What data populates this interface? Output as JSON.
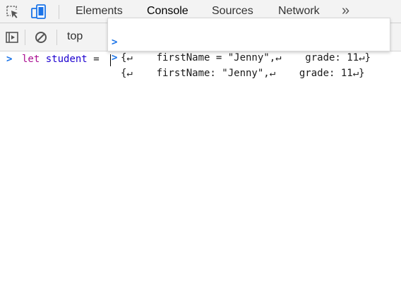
{
  "devtools": {
    "tabs": [
      {
        "label": "Elements",
        "active": false
      },
      {
        "label": "Console",
        "active": true
      },
      {
        "label": "Sources",
        "active": false
      },
      {
        "label": "Network",
        "active": false
      }
    ],
    "more_tabs_glyph": "»",
    "icons": {
      "inspect": "inspect-element-icon",
      "device": "device-toolbar-icon",
      "sidebar": "show-console-sidebar-icon",
      "clear": "clear-console-icon",
      "more": "more-tabs-icon"
    }
  },
  "console": {
    "context": "top",
    "prompt": {
      "keyword": "let",
      "identifier": "student",
      "operator": "="
    },
    "autocomplete": [
      "{↵    firstName = \"Jenny\",↵    grade: 11↵}",
      "{↵    firstName: \"Jenny\",↵    grade: 11↵}"
    ]
  },
  "colors": {
    "accent": "#1a73e8",
    "keyword": "#aa0d91",
    "identifier": "#1c00cf"
  }
}
